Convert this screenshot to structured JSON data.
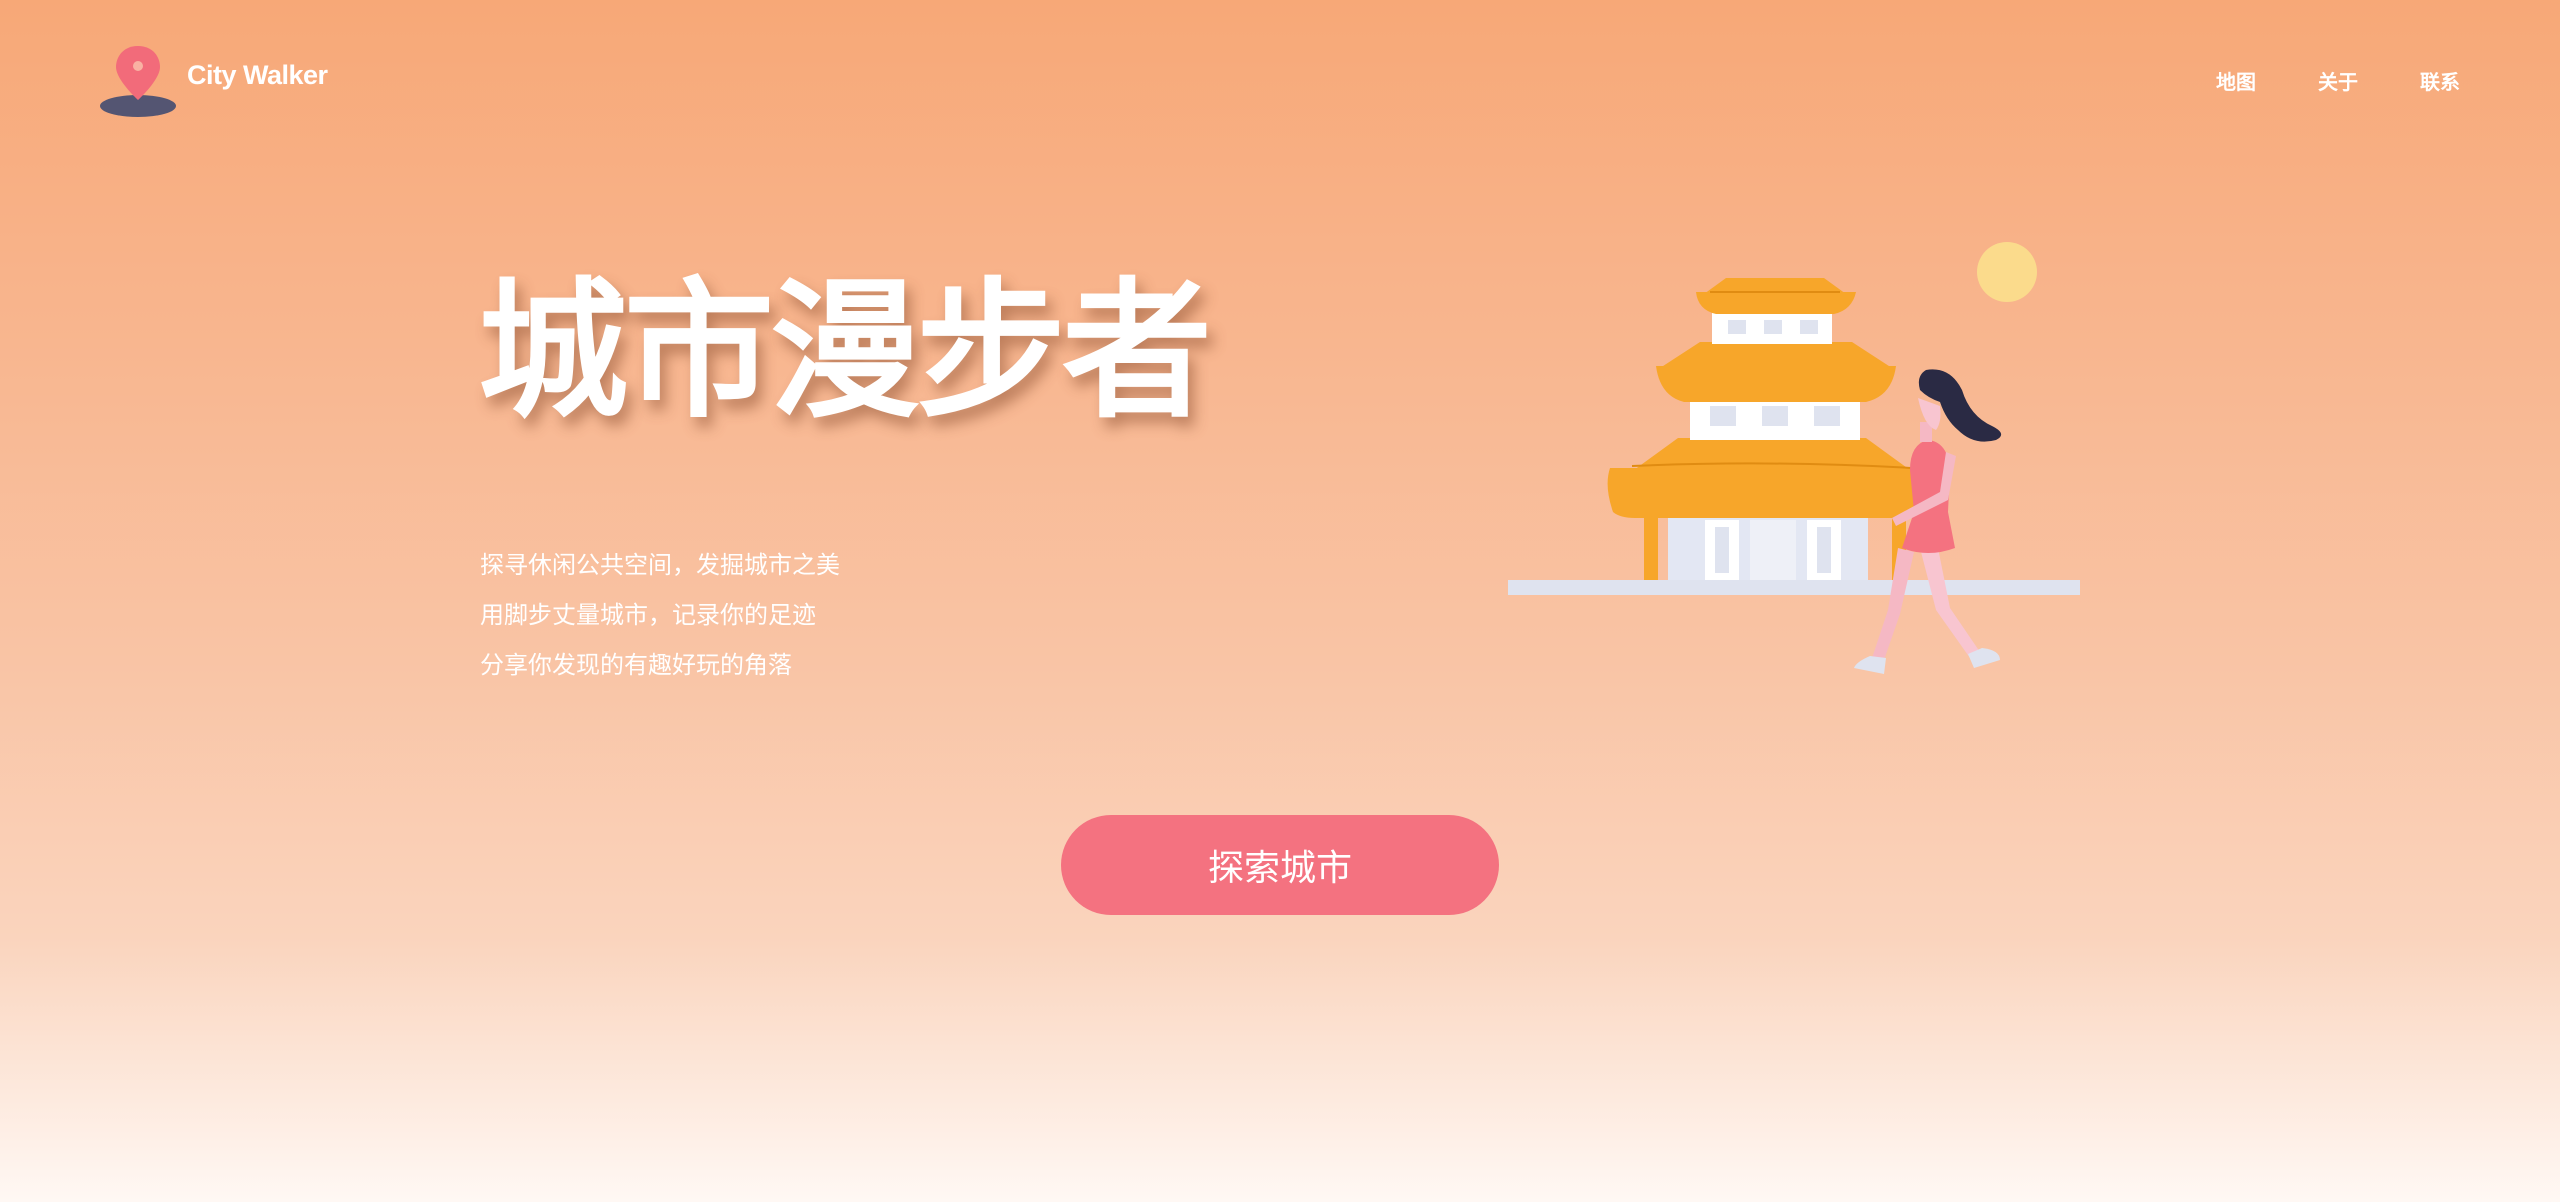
{
  "header": {
    "brand": "City Walker",
    "nav": [
      "地图",
      "关于",
      "联系"
    ]
  },
  "hero": {
    "title": "城市漫步者",
    "lines": [
      "探寻休闲公共空间，发掘城市之美",
      "用脚步丈量城市，记录你的足迹",
      "分享你发现的有趣好玩的角落"
    ],
    "cta": "探索城市"
  },
  "icons": {
    "logo": "map-pin-icon",
    "illustration": "pagoda-walking-woman-illustration"
  },
  "colors": {
    "background_top": "#f7a877",
    "background_bottom": "#fff8f4",
    "cta": "#f47280",
    "pin": "#f26b7a",
    "pagoda_roof": "#f7a62a",
    "sun": "#fbdb8c"
  }
}
